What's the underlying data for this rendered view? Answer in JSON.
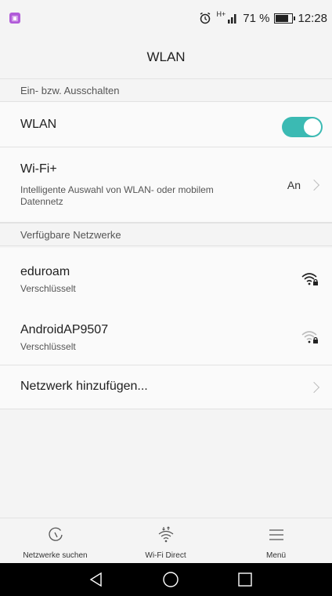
{
  "status_bar": {
    "notification_icon": "gallery-notification-icon",
    "alarm_icon": "alarm-clock-icon",
    "network_type": "H+",
    "signal_icon": "cell-signal-icon",
    "battery_percent_label": "71 %",
    "battery_level": 0.71,
    "time": "12:28"
  },
  "header": {
    "title": "WLAN"
  },
  "sections": {
    "toggle_header": "Ein- bzw. Ausschalten",
    "networks_header": "Verfügbare Netzwerke"
  },
  "wlan_toggle": {
    "label": "WLAN",
    "state": "on",
    "accent": "#3bbab3"
  },
  "wifi_plus": {
    "title": "Wi-Fi+",
    "subtitle_line1": "Intelligente Auswahl von WLAN- oder mobilem",
    "subtitle_line2": "Datennetz",
    "value": "An"
  },
  "networks": [
    {
      "ssid": "eduroam",
      "security": "Verschlüsselt",
      "icon": "wifi-locked-strong-icon"
    },
    {
      "ssid": "AndroidAP9507",
      "security": "Verschlüsselt",
      "icon": "wifi-locked-weak-icon"
    }
  ],
  "add_network": {
    "label": "Netzwerk hinzufügen..."
  },
  "bottom_nav": [
    {
      "label": "Netzwerke suchen",
      "icon": "refresh-scan-icon"
    },
    {
      "label": "Wi-Fi Direct",
      "icon": "wifi-direct-icon"
    },
    {
      "label": "Menü",
      "icon": "menu-icon"
    }
  ],
  "system_nav": [
    "back-icon",
    "home-icon",
    "recents-icon"
  ]
}
